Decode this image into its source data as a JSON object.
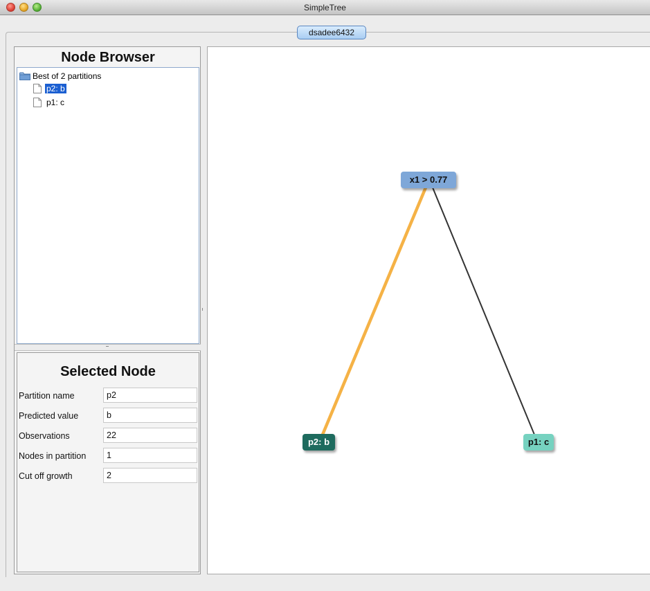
{
  "window": {
    "title": "SimpleTree"
  },
  "tab": {
    "label": "dsadee6432"
  },
  "node_browser": {
    "title": "Node Browser",
    "root_label": "Best of 2 partitions",
    "items": [
      {
        "label": "p2: b",
        "selected": true
      },
      {
        "label": "p1: c",
        "selected": false
      }
    ]
  },
  "selected_node": {
    "title": "Selected Node",
    "fields": [
      {
        "label": "Partition name",
        "value": "p2"
      },
      {
        "label": "Predicted value",
        "value": "b"
      },
      {
        "label": "Observations",
        "value": "22"
      },
      {
        "label": "Nodes in partition",
        "value": "1"
      },
      {
        "label": "Cut off growth",
        "value": "2"
      }
    ]
  },
  "tree": {
    "root": {
      "label": "x1 > 0.77",
      "color": "#7ea7d8"
    },
    "left_child": {
      "label": "p2: b",
      "color": "#1e6b5e",
      "edge_color": "#f5b246"
    },
    "right_child": {
      "label": "p1: c",
      "color": "#76d2c0",
      "edge_color": "#333333"
    }
  },
  "colors": {
    "selection": "#1b5fd1",
    "tab_border": "#5a86c0"
  },
  "icons": {
    "root_icon": "folder-icon",
    "leaf_icon": "file-icon"
  }
}
